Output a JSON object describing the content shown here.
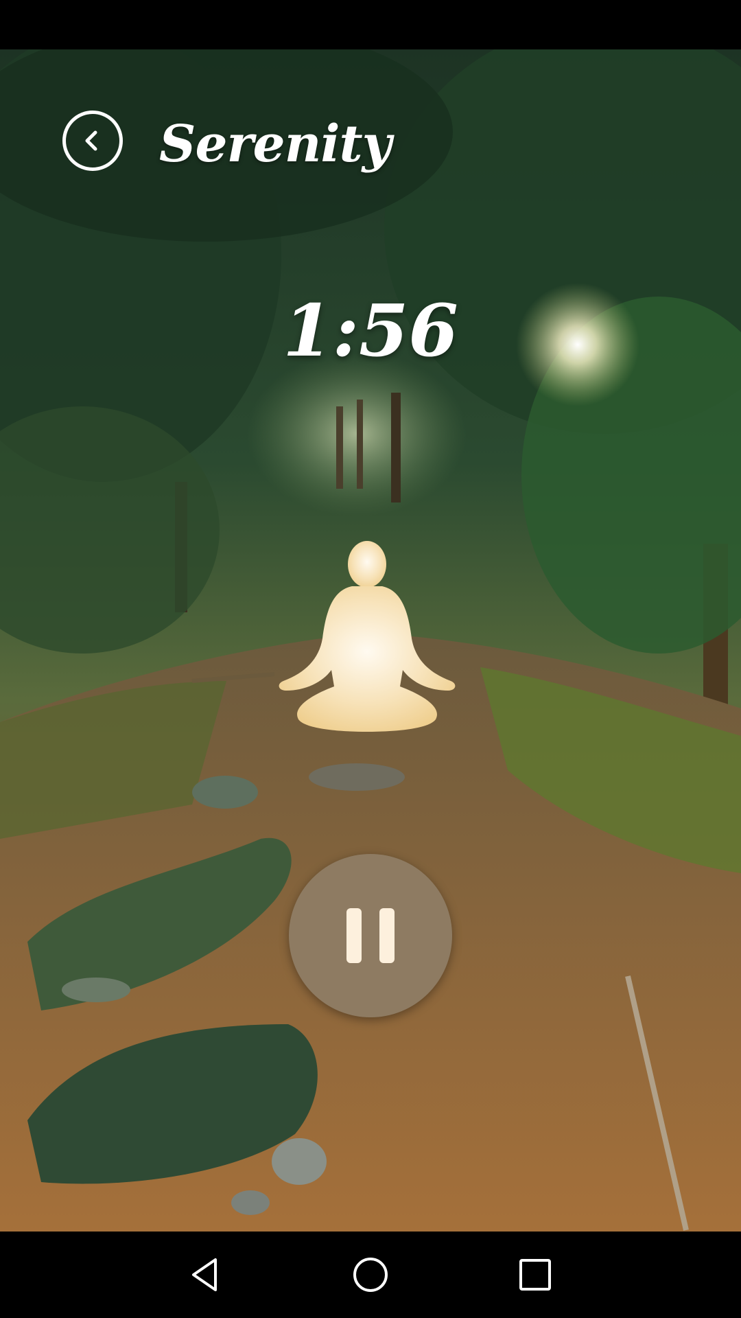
{
  "app": {
    "title": "Serenity"
  },
  "session": {
    "timer_display": "1:56",
    "state": "playing"
  },
  "icons": {
    "back": "chevron-left-circle-icon",
    "pause": "pause-icon",
    "figure": "meditation-lotus-icon",
    "nav_back": "triangle-back-icon",
    "nav_home": "circle-home-icon",
    "nav_recents": "square-recents-icon"
  },
  "colors": {
    "pause_button_bg": "#8e7b62",
    "pause_bars": "#fdf0dd",
    "figure_glow": "#f6d9a0",
    "text": "#ffffff"
  }
}
